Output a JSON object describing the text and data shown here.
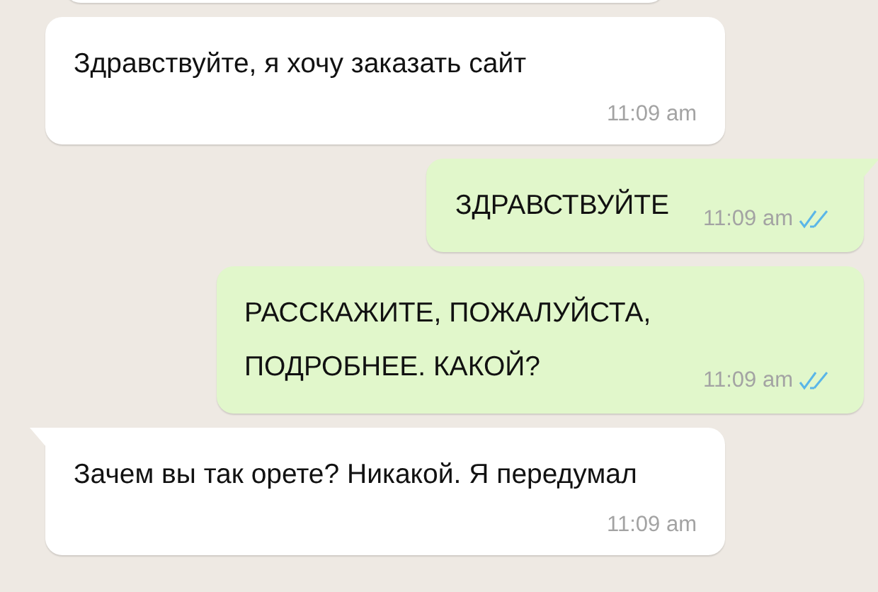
{
  "messages": [
    {
      "kind": "incoming",
      "tail": false,
      "text": "Здравствуйте, я хочу заказать сайт",
      "time": "11:09 am"
    },
    {
      "kind": "outgoing",
      "tail": true,
      "text": "ЗДРАВСТВУЙТЕ",
      "time": "11:09 am",
      "read": true
    },
    {
      "kind": "outgoing",
      "tail": false,
      "text": "РАССКАЖИТЕ, ПОЖАЛУЙСТА, ПОДРОБНЕЕ. КАКОЙ?",
      "time": "11:09 am",
      "read": true
    },
    {
      "kind": "incoming",
      "tail": true,
      "text": "Зачем вы так орете? Никакой. Я передумал",
      "time": "11:09 am"
    }
  ]
}
